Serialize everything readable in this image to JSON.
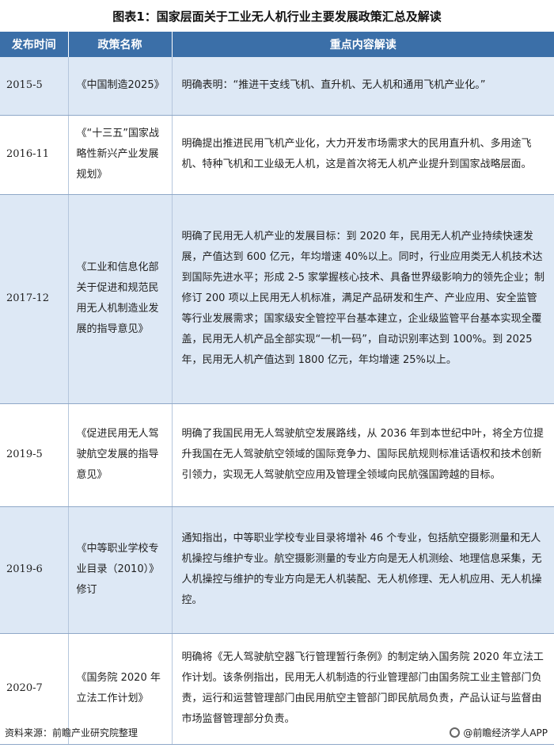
{
  "title": "图表1：国家层面关于工业无人机行业主要发展政策汇总及解读",
  "table": {
    "headers": [
      "发布时间",
      "政策名称",
      "重点内容解读"
    ],
    "rows": [
      {
        "date": "2015-5",
        "name": "《中国制造2025》",
        "content": "明确表明：“推进干支线飞机、直升机、无人机和通用飞机产业化。”"
      },
      {
        "date": "2016-11",
        "name": "《“十三五”国家战略性新兴产业发展规划》",
        "content": "明确提出推进民用飞机产业化，大力开发市场需求大的民用直升机、多用途飞机、特种飞机和工业级无人机，这是首次将无人机产业提升到国家战略层面。"
      },
      {
        "date": "2017-12",
        "name": "《工业和信息化部关于促进和规范民用无人机制造业发展的指导意见》",
        "content": "明确了民用无人机产业的发展目标：到 2020 年，民用无人机产业持续快速发展，产值达到 600 亿元，年均增速 40%以上。同时，行业应用类无人机技术达到国际先进水平；形成 2-5 家掌握核心技术、具备世界级影响力的领先企业；制修订 200 项以上民用无人机标准，满足产品研发和生产、产业应用、安全监管等行业发展需求；国家级安全管控平台基本建立，企业级监管平台基本实现全覆盖，民用无人机产品全部实现“一机一码”，自动识别率达到 100%。到 2025 年，民用无人机产值达到 1800 亿元，年均增速 25%以上。"
      },
      {
        "date": "2019-5",
        "name": "《促进民用无人驾驶航空发展的指导意见》",
        "content": "明确了我国民用无人驾驶航空发展路线，从 2036 年到本世纪中叶，将全方位提升我国在无人驾驶航空领域的国际竞争力、国际民航规则标准话语权和技术创新引领力，实现无人驾驶航空应用及管理全领域向民航强国跨越的目标。"
      },
      {
        "date": "2019-6",
        "name": "《中等职业学校专业目录（2010）》修订",
        "content": "通知指出，中等职业学校专业目录将增补 46 个专业，包括航空摄影测量和无人机操控与维护专业。航空摄影测量的专业方向是无人机测绘、地理信息采集，无人机操控与维护的专业方向是无人机装配、无人机修理、无人机应用、无人机操控。"
      },
      {
        "date": "2020-7",
        "name": "《国务院 2020 年立法工作计划》",
        "content": "明确将《无人驾驶航空器飞行管理暂行条例》的制定纳入国务院 2020 年立法工作计划。该条例指出，民用无人机制造的行业管理部门由国务院工业主管部门负责，运行和运营管理部门由民用航空主管部门即民航局负责，产品认证与监督由市场监督管理部分负责。"
      }
    ]
  },
  "footer": {
    "source": "资料来源：前瞻产业研究院整理",
    "brand": "@前瞻经济学人APP"
  }
}
